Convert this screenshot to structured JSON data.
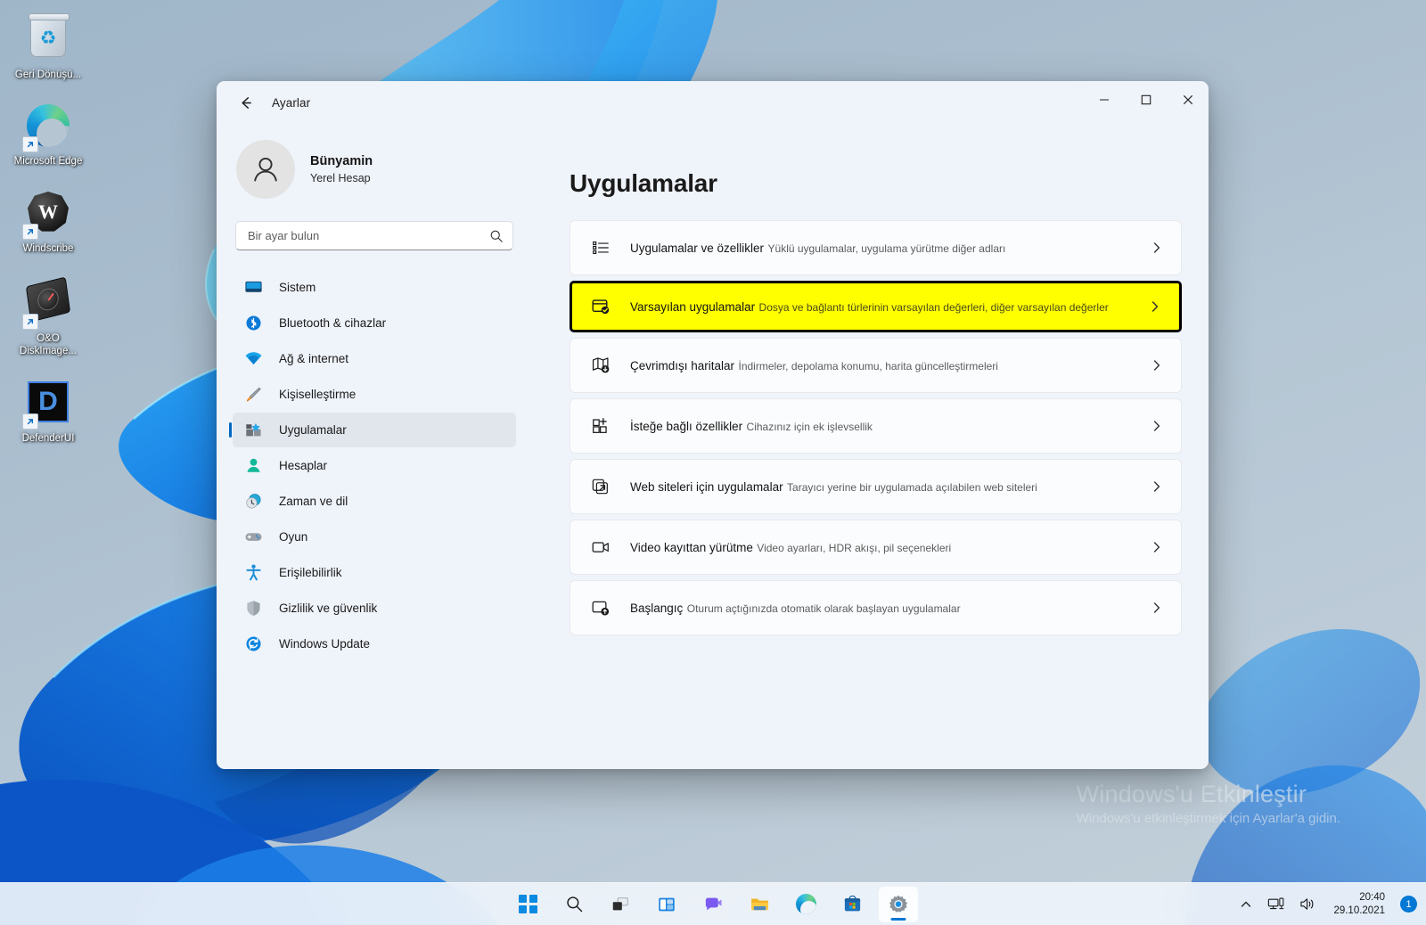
{
  "desktop": {
    "icons": [
      {
        "name": "Geri Dönüşü...",
        "icon": "recycle-bin-icon"
      },
      {
        "name": "Microsoft Edge",
        "icon": "edge-icon"
      },
      {
        "name": "Windscribe",
        "icon": "windscribe-icon"
      },
      {
        "name": "O&O DiskImage...",
        "icon": "oo-diskimage-icon"
      },
      {
        "name": "DefenderUI",
        "icon": "defenderui-icon"
      }
    ],
    "watermark": {
      "title": "Windows'u Etkinleştir",
      "subtitle": "Windows'u etkinleştirmek için Ayarlar'a gidin."
    }
  },
  "window": {
    "title": "Ayarlar",
    "back_label": "←",
    "controls": {
      "minimize": "minimize-icon",
      "maximize": "maximize-icon",
      "close": "close-icon"
    }
  },
  "sidebar": {
    "account": {
      "name": "Bünyamin",
      "type": "Yerel Hesap",
      "avatar": "person-avatar-icon"
    },
    "search": {
      "placeholder": "Bir ayar bulun",
      "value": "",
      "icon": "search-icon"
    },
    "items": [
      {
        "label": "Sistem",
        "icon": "monitor-icon",
        "active": false
      },
      {
        "label": "Bluetooth & cihazlar",
        "icon": "bluetooth-icon",
        "active": false
      },
      {
        "label": "Ağ & internet",
        "icon": "wifi-icon",
        "active": false
      },
      {
        "label": "Kişiselleştirme",
        "icon": "paintbrush-icon",
        "active": false
      },
      {
        "label": "Uygulamalar",
        "icon": "apps-icon",
        "active": true
      },
      {
        "label": "Hesaplar",
        "icon": "person-icon",
        "active": false
      },
      {
        "label": "Zaman ve dil",
        "icon": "clock-globe-icon",
        "active": false
      },
      {
        "label": "Oyun",
        "icon": "gamepad-icon",
        "active": false
      },
      {
        "label": "Erişilebilirlik",
        "icon": "accessibility-icon",
        "active": false
      },
      {
        "label": "Gizlilik ve güvenlik",
        "icon": "shield-icon",
        "active": false
      },
      {
        "label": "Windows Update",
        "icon": "update-icon",
        "active": false
      }
    ]
  },
  "main": {
    "page_title": "Uygulamalar",
    "cards": [
      {
        "title": "Uygulamalar ve özellikler",
        "subtitle": "Yüklü uygulamalar, uygulama yürütme diğer adları",
        "icon": "list-icon",
        "chevron": "chevron-right-icon",
        "highlighted": false
      },
      {
        "title": "Varsayılan uygulamalar",
        "subtitle": "Dosya ve bağlantı türlerinin varsayılan değerleri, diğer varsayılan değerler",
        "icon": "default-apps-check-icon",
        "chevron": "chevron-right-icon",
        "highlighted": true
      },
      {
        "title": "Çevrimdışı haritalar",
        "subtitle": "İndirmeler, depolama konumu, harita güncelleştirmeleri",
        "icon": "map-download-icon",
        "chevron": "chevron-right-icon",
        "highlighted": false
      },
      {
        "title": "İsteğe bağlı özellikler",
        "subtitle": "Cihazınız için ek işlevsellik",
        "icon": "grid-plus-icon",
        "chevron": "chevron-right-icon",
        "highlighted": false
      },
      {
        "title": "Web siteleri için uygulamalar",
        "subtitle": "Tarayıcı yerine bir uygulamada açılabilen web siteleri",
        "icon": "external-link-icon",
        "chevron": "chevron-right-icon",
        "highlighted": false
      },
      {
        "title": "Video kayıttan yürütme",
        "subtitle": "Video ayarları, HDR akışı, pil seçenekleri",
        "icon": "video-camera-icon",
        "chevron": "chevron-right-icon",
        "highlighted": false
      },
      {
        "title": "Başlangıç",
        "subtitle": "Oturum açtığınızda otomatik olarak başlayan uygulamalar",
        "icon": "startup-icon",
        "chevron": "chevron-right-icon",
        "highlighted": false
      }
    ]
  },
  "taskbar": {
    "buttons": [
      {
        "name": "start-button",
        "icon": "windows-logo-icon",
        "active": false
      },
      {
        "name": "search-button",
        "icon": "search-icon",
        "active": false
      },
      {
        "name": "task-view-button",
        "icon": "task-view-icon",
        "active": false
      },
      {
        "name": "widgets-button",
        "icon": "widgets-icon",
        "active": false
      },
      {
        "name": "chat-button",
        "icon": "chat-icon",
        "active": false
      },
      {
        "name": "file-explorer-button",
        "icon": "folder-icon",
        "active": false
      },
      {
        "name": "edge-button",
        "icon": "edge-icon",
        "active": false
      },
      {
        "name": "store-button",
        "icon": "store-icon",
        "active": false
      },
      {
        "name": "settings-button",
        "icon": "gear-icon",
        "active": true
      }
    ],
    "tray": {
      "chevron": "chevron-up-icon",
      "network": "network-icon",
      "volume": "volume-icon",
      "time": "20:40",
      "date": "29.10.2021",
      "notification_count": "1"
    }
  },
  "colors": {
    "accent": "#0078d4",
    "highlight": "#ffff00",
    "highlight_border": "#000000",
    "window_bg": "#eff3fa",
    "card_bg": "#fbfcfe"
  }
}
